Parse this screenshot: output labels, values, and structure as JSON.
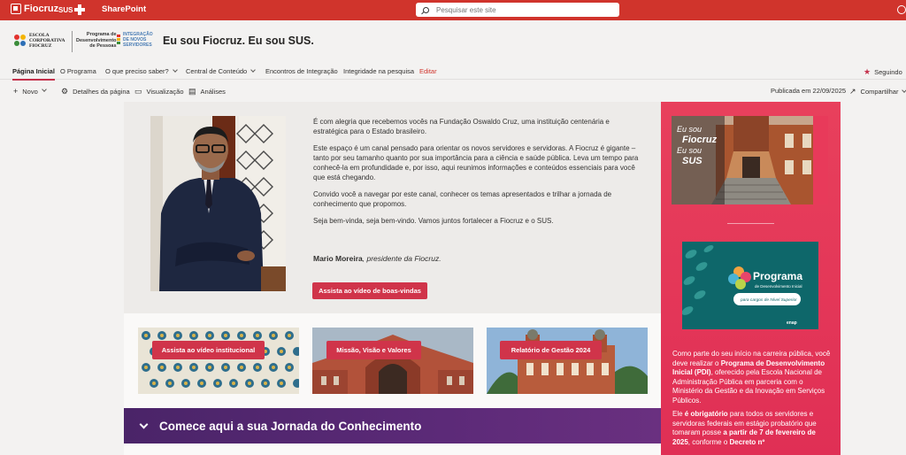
{
  "suite": {
    "brand": "Fiocruz",
    "sus": "SUS",
    "app_name": "SharePoint",
    "search_placeholder": "Pesquisar este site"
  },
  "header": {
    "escola_logo_lines": [
      "ESCOLA",
      "CORPORATIVA",
      "FIOCRUZ"
    ],
    "programa_lines": [
      "Programa de",
      "Desenvolvimento",
      "de Pessoas"
    ],
    "integracao_lines": [
      "INTEGRAÇÃO",
      "DE NOVOS",
      "SERVIDORES"
    ],
    "site_title": "Eu sou Fiocruz. Eu sou SUS."
  },
  "nav": {
    "items": [
      {
        "label": "Página Inicial"
      },
      {
        "label": "O Programa"
      },
      {
        "label": "O que preciso saber?"
      },
      {
        "label": "Central de Conteúdo"
      },
      {
        "label": "Encontros de Integração"
      },
      {
        "label": "Integridade na pesquisa"
      },
      {
        "label": "Editar"
      }
    ],
    "follow_label": "Seguindo"
  },
  "commandbar": {
    "new_label": "Novo",
    "details_label": "Detalhes da página",
    "view_label": "Visualização",
    "analytics_label": "Análises",
    "published": "Publicada em 22/09/2025",
    "share_label": "Compartilhar"
  },
  "welcome": {
    "paragraphs": [
      "É com alegria que recebemos vocês na Fundação Oswaldo Cruz, uma instituição centenária e estratégica para o Estado brasileiro.",
      "Este espaço é um canal pensado para orientar os novos servidores e servidoras. A Fiocruz é gigante – tanto por seu tamanho quanto por sua importância para a ciência e saúde pública. Leva um tempo para conhecê-la em profundidade e, por isso, aqui reunimos informações e conteúdos essenciais para você que está chegando.",
      "Convido você a navegar por este canal, conhecer os temas apresentados e trilhar a jornada de conhecimento que propomos.",
      "Seja bem-vinda, seja bem-vindo. Vamos juntos fortalecer a Fiocruz e o SUS."
    ],
    "signature_name": "Mario Moreira",
    "signature_role": ", presidente da Fiocruz.",
    "video_button": "Assista ao vídeo de boas-vindas"
  },
  "cards": [
    {
      "label": "Assista ao vídeo institucional"
    },
    {
      "label": "Missão, Visão e Valores"
    },
    {
      "label": "Relatório de Gestão 2024"
    }
  ],
  "journey": {
    "title": "Comece aqui a sua Jornada do Conhecimento"
  },
  "right": {
    "banner_lines": [
      "Eu sou",
      "Fiocruz",
      "Eu sou",
      "SUS"
    ],
    "programa_title": "Programa",
    "programa_sub": "de Desenvolvimento Inicial",
    "programa_pill": "para cargos de Nível Superior",
    "enap": "enap",
    "p1_a": "Como parte do seu início na carreira pública, você deve realizar o ",
    "p1_b": "Programa de Desenvolvimento Inicial (PDI)",
    "p1_c": ", oferecido pela Escola Nacional de Administração Pública em parceria com o Ministério da Gestão e da Inovação em Serviços Públicos.",
    "p2_a": "Ele ",
    "p2_b": "é obrigatório",
    "p2_c": " para todos os servidores e servidoras federais em estágio probatório que tomaram posse ",
    "p2_d": "a partir de 7 de fevereiro de 2025",
    "p2_e": ", conforme o ",
    "p2_f": "Decreto nº"
  },
  "colors": {
    "suite_red": "#d0342c",
    "accent_red": "#d0344a",
    "right_pink": "#e33a58",
    "journey_purple": "#4a2468",
    "teal": "#0f6b6e"
  }
}
